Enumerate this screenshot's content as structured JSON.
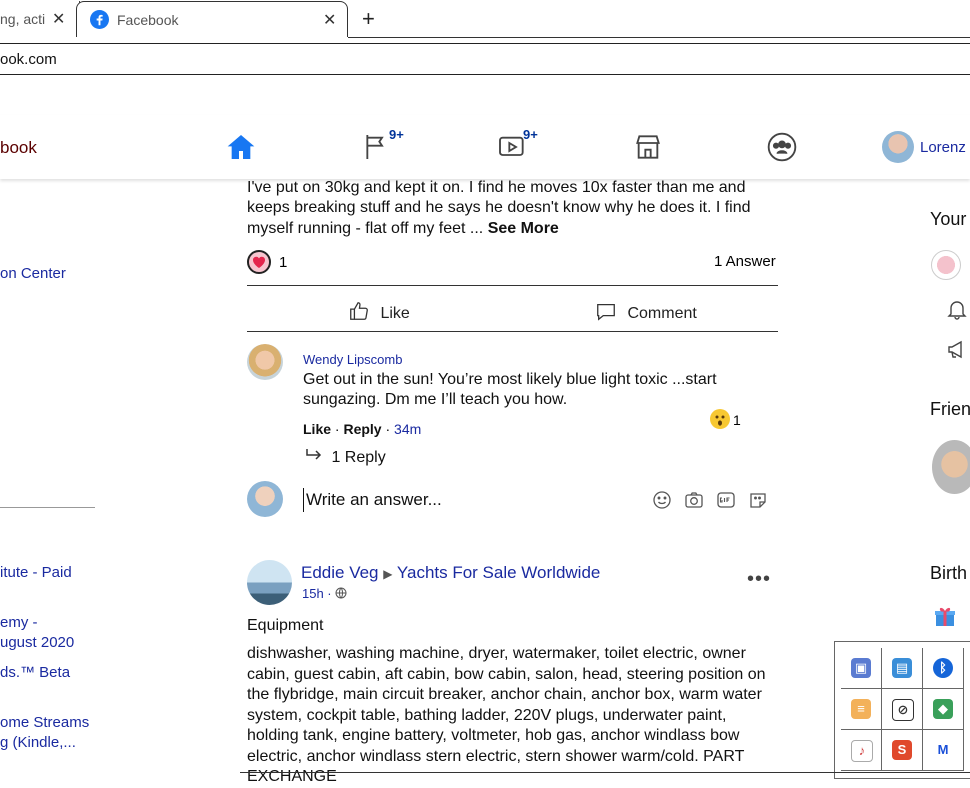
{
  "browser": {
    "tabs": [
      {
        "label": "ng, acti",
        "state": "inactive"
      },
      {
        "label": "Facebook",
        "state": "active"
      }
    ],
    "new_tab_symbol": "+",
    "close_symbol": "✕",
    "url": "ook.com"
  },
  "header": {
    "brand": "book",
    "nav": [
      {
        "icon": "home-icon",
        "badge": ""
      },
      {
        "icon": "flag-icon",
        "badge": "9+"
      },
      {
        "icon": "watch-icon",
        "badge": "9+"
      },
      {
        "icon": "marketplace-icon",
        "badge": ""
      },
      {
        "icon": "groups-icon",
        "badge": ""
      }
    ],
    "profile_name": "Lorenz",
    "colors": {
      "accent": "#1a2aa0",
      "home_active": "#1877f2"
    }
  },
  "left": {
    "links": [
      "on Center",
      "itute - Paid",
      "emy -",
      "ugust 2020",
      "ds.™ Beta",
      "ome Streams",
      "g (Kindle,..."
    ]
  },
  "feed": {
    "question": {
      "text_lines": [
        "I've put on 30kg and kept it on. I find he moves 10x faster than me and",
        "keeps breaking stuff and he says he doesn't know why he does it. I find",
        "myself running - flat off my feet ... "
      ],
      "see_more": "See More",
      "like_count": "1",
      "answers": "1 Answer",
      "like_label": "Like",
      "comment_label": "Comment"
    },
    "comment": {
      "author": "Wendy Lipscomb",
      "text": "Get out in the sun! You’re most likely blue light toxic ...start sungazing. Dm me I’ll teach you how.",
      "like": "Like",
      "reply": "Reply",
      "time": "34m",
      "reaction_count": "1",
      "replies": "1 Reply"
    },
    "answer_input": {
      "placeholder": "Write an answer..."
    },
    "post": {
      "author": "Eddie Veg",
      "group": "Yachts For Sale Worldwide",
      "meta": "15h · ",
      "title": "Equipment",
      "body": "dishwasher, washing machine, dryer, watermaker, toilet electric, owner cabin, guest cabin, aft cabin, bow cabin, salon, head, steering position on the flybridge, main circuit breaker, anchor chain, anchor box, warm water system, cockpit table, bathing ladder, 220V plugs, underwater paint, holding tank, engine battery, voltmeter, hob gas, anchor windlass bow electric, anchor windlass stern electric, stern shower warm/cold. PART EXCHANGE"
    }
  },
  "right": {
    "labels": [
      "Your",
      "Frien",
      "Birth"
    ]
  },
  "tray": {
    "icons": [
      "shield-app-icon",
      "monitor-app-icon",
      "bluetooth-icon",
      "dropbox-icon",
      "cloud-off-icon",
      "network-icon",
      "audio-app-icon",
      "s-app-icon",
      "malwarebytes-icon"
    ]
  }
}
